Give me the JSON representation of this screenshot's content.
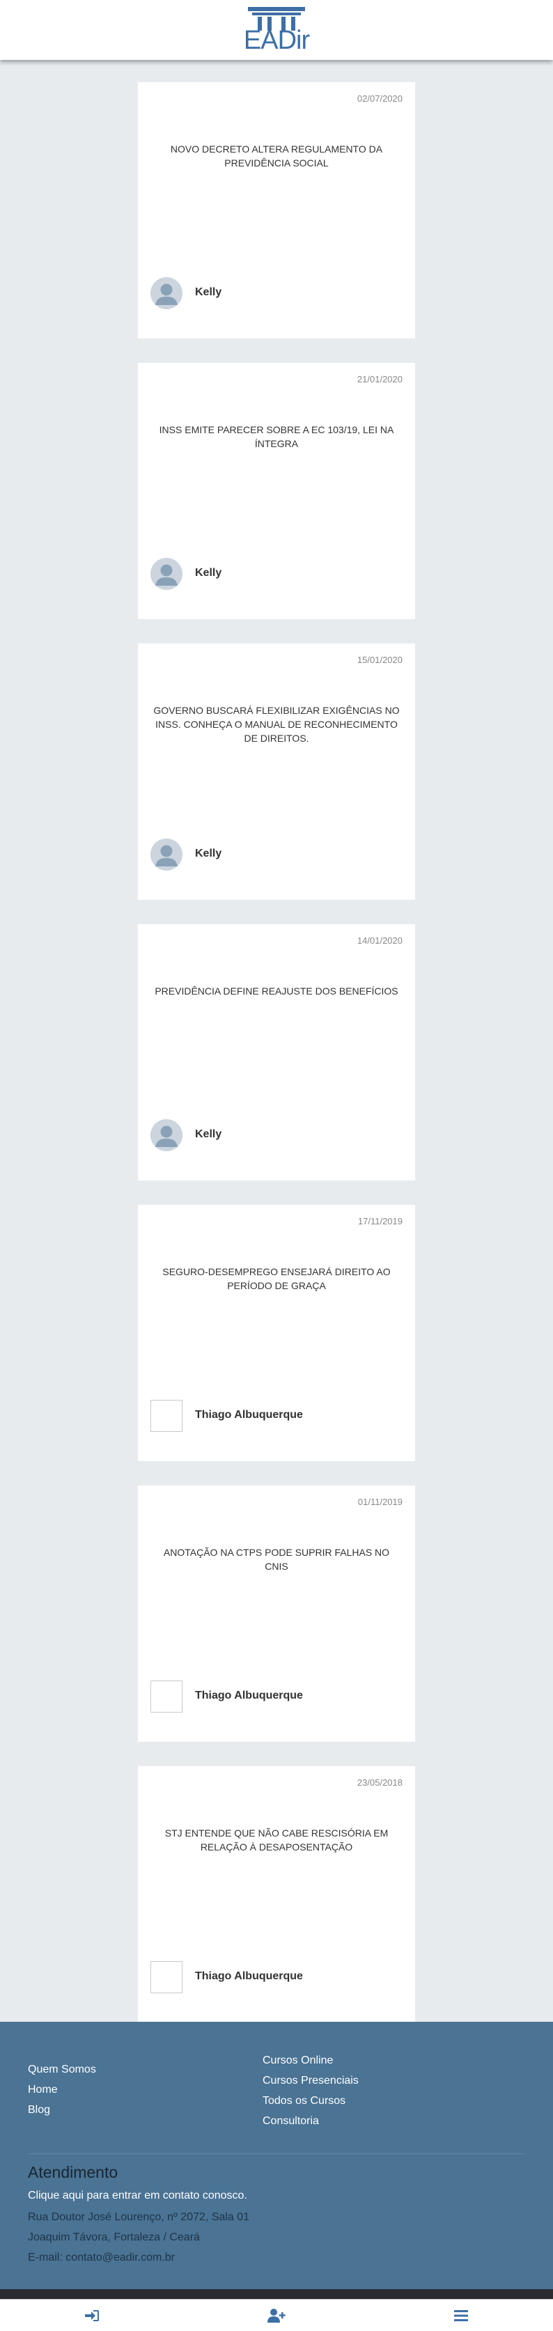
{
  "header": {
    "logo_text": "EADir"
  },
  "posts": [
    {
      "date": "02/07/2020",
      "title": "Novo decreto altera regulamento da Previdência Social",
      "author": "Kelly",
      "avatar": "default"
    },
    {
      "date": "21/01/2020",
      "title": "INSS emite parecer sobre a EC 103/19, lei na íntegra",
      "author": "Kelly",
      "avatar": "default"
    },
    {
      "date": "15/01/2020",
      "title": "Governo buscará flexibilizar exigências no INSS. Conheça o Manual de Reconhecimento de Direitos.",
      "author": "Kelly",
      "avatar": "default"
    },
    {
      "date": "14/01/2020",
      "title": "Previdência define reajuste dos benefícios",
      "author": "Kelly",
      "avatar": "default"
    },
    {
      "date": "17/11/2019",
      "title": "Seguro-desemprego ensejará direito ao período de graça",
      "author": "Thiago Albuquerque",
      "avatar": "broken"
    },
    {
      "date": "01/11/2019",
      "title": "Anotação na CTPS pode suprir falhas no CNIS",
      "author": "Thiago Albuquerque",
      "avatar": "broken"
    },
    {
      "date": "23/05/2018",
      "title": "STJ entende que não cabe rescisória em relação à desaposentação",
      "author": "Thiago Albuquerque",
      "avatar": "broken"
    }
  ],
  "footer": {
    "links_left": [
      "Quem Somos",
      "Home",
      "Blog"
    ],
    "links_right": [
      "Cursos Online",
      "Cursos Presenciais",
      "Todos os Cursos",
      "Consultoria"
    ],
    "contact_title": "Atendimento",
    "contact_cta": "Clique aqui para entrar em contato conosco.",
    "address_line1": "Rua Doutor José Lourenço, nº 2072, Sala 01",
    "address_line2": "Joaquim Távora, Fortaleza / Ceará",
    "email": "E-mail: contato@eadir.com.br"
  },
  "bottom_nav": {
    "icons": [
      "sign-in-icon",
      "add-user-icon",
      "menu-icon"
    ],
    "color": "#3d6fa5"
  }
}
